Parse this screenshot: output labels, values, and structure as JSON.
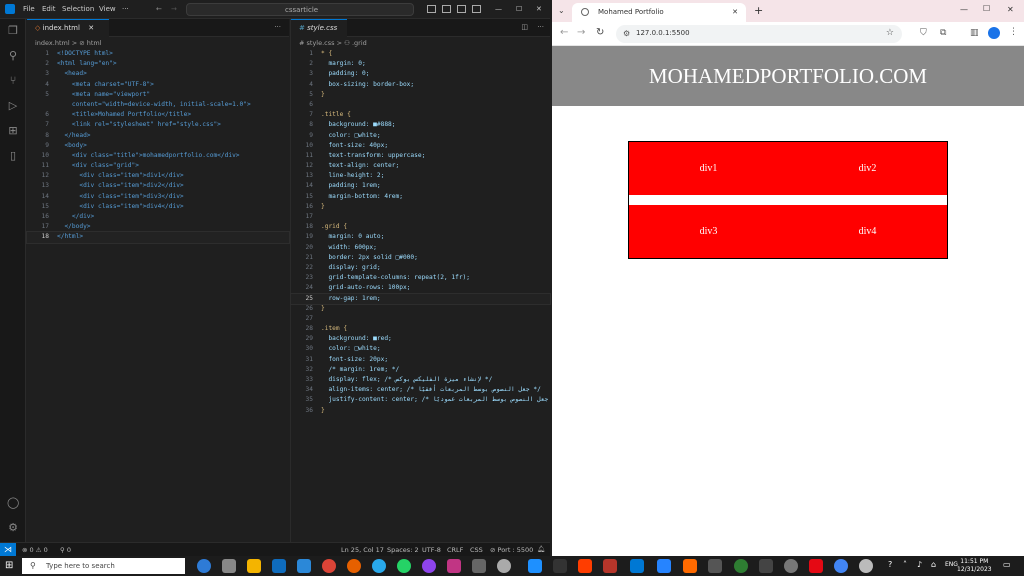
{
  "vscode": {
    "menu": [
      "File",
      "Edit",
      "Selection",
      "View",
      "···"
    ],
    "command_center": "cssarticle",
    "left_tab": "index.html",
    "left_breadcrumb": "index.html > ⊘ html",
    "right_tab": "style.css",
    "right_breadcrumb": "# style.css > ⚇ .grid",
    "html_lines": [
      {
        "n": "1",
        "t": "<!DOCTYPE html>"
      },
      {
        "n": "2",
        "t": "<html lang=\"en\">"
      },
      {
        "n": "3",
        "t": "  <head>"
      },
      {
        "n": "4",
        "t": "    <meta charset=\"UTF-8\">"
      },
      {
        "n": "5",
        "t": "    <meta name=\"viewport\""
      },
      {
        "n": "",
        "t": "    content=\"width=device-width, initial-scale=1.0\">"
      },
      {
        "n": "6",
        "t": "    <title>Mohamed Portfolio</title>"
      },
      {
        "n": "7",
        "t": "    <link rel=\"stylesheet\" href=\"style.css\">"
      },
      {
        "n": "8",
        "t": "  </head>"
      },
      {
        "n": "9",
        "t": "  <body>"
      },
      {
        "n": "10",
        "t": "    <div class=\"title\">mohamedportfolio.com</div>"
      },
      {
        "n": "11",
        "t": "    <div class=\"grid\">"
      },
      {
        "n": "12",
        "t": "      <div class=\"item\">div1</div>"
      },
      {
        "n": "13",
        "t": "      <div class=\"item\">div2</div>"
      },
      {
        "n": "14",
        "t": "      <div class=\"item\">div3</div>"
      },
      {
        "n": "15",
        "t": "      <div class=\"item\">div4</div>"
      },
      {
        "n": "16",
        "t": "    </div>"
      },
      {
        "n": "17",
        "t": "  </body>"
      },
      {
        "n": "18",
        "t": "</html>"
      }
    ],
    "css_lines": [
      {
        "n": "1",
        "t": "* {"
      },
      {
        "n": "2",
        "t": "  margin: 0;"
      },
      {
        "n": "3",
        "t": "  padding: 0;"
      },
      {
        "n": "4",
        "t": "  box-sizing: border-box;"
      },
      {
        "n": "5",
        "t": "}"
      },
      {
        "n": "6",
        "t": ""
      },
      {
        "n": "7",
        "t": ".title {"
      },
      {
        "n": "8",
        "t": "  background: ■#888;"
      },
      {
        "n": "9",
        "t": "  color: □white;"
      },
      {
        "n": "10",
        "t": "  font-size: 40px;"
      },
      {
        "n": "11",
        "t": "  text-transform: uppercase;"
      },
      {
        "n": "12",
        "t": "  text-align: center;"
      },
      {
        "n": "13",
        "t": "  line-height: 2;"
      },
      {
        "n": "14",
        "t": "  padding: 1rem;"
      },
      {
        "n": "15",
        "t": "  margin-bottom: 4rem;"
      },
      {
        "n": "16",
        "t": "}"
      },
      {
        "n": "17",
        "t": ""
      },
      {
        "n": "18",
        "t": ".grid {"
      },
      {
        "n": "19",
        "t": "  margin: 0 auto;"
      },
      {
        "n": "20",
        "t": "  width: 600px;"
      },
      {
        "n": "21",
        "t": "  border: 2px solid □#000;"
      },
      {
        "n": "22",
        "t": "  display: grid;"
      },
      {
        "n": "23",
        "t": "  grid-template-columns: repeat(2, 1fr);"
      },
      {
        "n": "24",
        "t": "  grid-auto-rows: 100px;"
      },
      {
        "n": "25",
        "t": "  row-gap: 1rem;"
      },
      {
        "n": "26",
        "t": "}"
      },
      {
        "n": "27",
        "t": ""
      },
      {
        "n": "28",
        "t": ".item {"
      },
      {
        "n": "29",
        "t": "  background: ■red;"
      },
      {
        "n": "30",
        "t": "  color: □white;"
      },
      {
        "n": "31",
        "t": "  font-size: 20px;"
      },
      {
        "n": "32",
        "t": "  /* margin: 1rem; */"
      },
      {
        "n": "33",
        "t": "  display: flex; /* لإنشاء ميزة الفليكس بوكس */"
      },
      {
        "n": "34",
        "t": "  align-items: center; /* جعل النصوص بوسط المربعات أفقيًا */"
      },
      {
        "n": "35",
        "t": "  justify-content: center; /* جعل النصوص بوسط المربعات عموديًا */"
      },
      {
        "n": "36",
        "t": "}"
      }
    ],
    "status": {
      "errors": "⊗ 0 ⚠ 0",
      "ports": "⚲ 0",
      "position": "Ln 25, Col 17",
      "spaces": "Spaces: 2",
      "encoding": "UTF-8",
      "eol": "CRLF",
      "language": "CSS",
      "port": "⊘ Port : 5500"
    }
  },
  "browser": {
    "tab_title": "Mohamed Portfolio",
    "url": "127.0.0.1:5500",
    "site_title": "mohamedportfolio.com",
    "items": [
      "div1",
      "div2",
      "div3",
      "div4"
    ],
    "colors": {
      "title_bg": "#888888",
      "item_bg": "#ff0000"
    }
  },
  "taskbar": {
    "search_placeholder": "Type here to search",
    "time": "11:51 PM",
    "date": "12/31/2023",
    "lang": "ENG"
  }
}
